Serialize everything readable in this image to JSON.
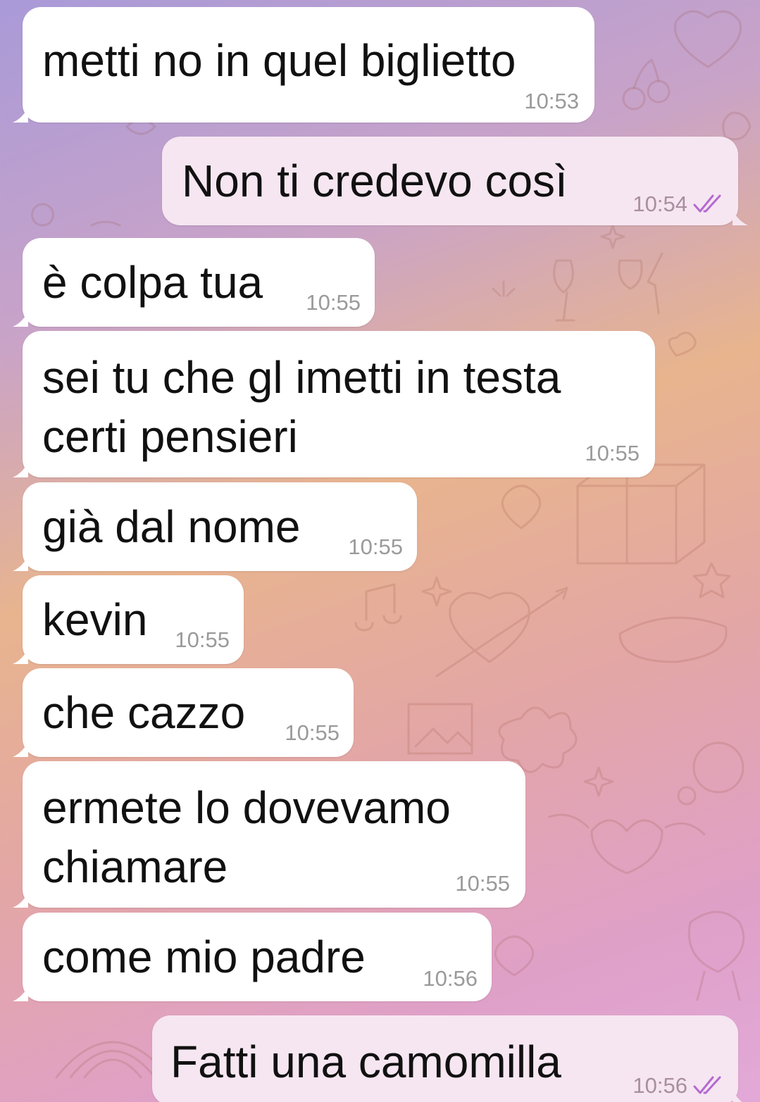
{
  "colors": {
    "incoming_bubble": "#ffffff",
    "outgoing_bubble": "#f6e6f1",
    "read_check": "#b46ad0",
    "time_text": "#9a9a9a"
  },
  "messages": [
    {
      "direction": "in",
      "lines": [
        "metti no in quel biglietto"
      ],
      "time": "10:53"
    },
    {
      "direction": "out",
      "lines": [
        "Non ti credevo così"
      ],
      "time": "10:54",
      "status_icon": "double-check-icon"
    },
    {
      "direction": "in",
      "lines": [
        "è colpa tua"
      ],
      "time": "10:55"
    },
    {
      "direction": "in",
      "lines": [
        "sei tu che gl imetti in testa",
        "certi pensieri"
      ],
      "time": "10:55"
    },
    {
      "direction": "in",
      "lines": [
        "già dal nome"
      ],
      "time": "10:55"
    },
    {
      "direction": "in",
      "lines": [
        "kevin"
      ],
      "time": "10:55"
    },
    {
      "direction": "in",
      "lines": [
        "che cazzo"
      ],
      "time": "10:55"
    },
    {
      "direction": "in",
      "lines": [
        "ermete lo dovevamo",
        "chiamare"
      ],
      "time": "10:55"
    },
    {
      "direction": "in",
      "lines": [
        "come mio padre"
      ],
      "time": "10:56"
    },
    {
      "direction": "out",
      "lines": [
        "Fatti una camomilla"
      ],
      "time": "10:56",
      "status_icon": "double-check-icon"
    }
  ]
}
